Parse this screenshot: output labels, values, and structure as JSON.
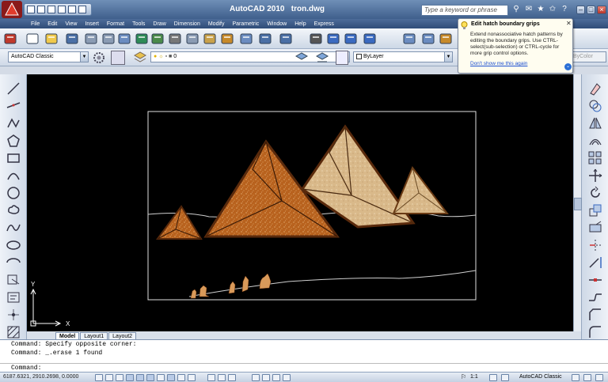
{
  "title_bar": {
    "app_title": "AutoCAD 2010",
    "file_name": "tron.dwg",
    "search_placeholder": "Type a keyword or phrase"
  },
  "menu": [
    "File",
    "Edit",
    "View",
    "Insert",
    "Format",
    "Tools",
    "Draw",
    "Dimension",
    "Modify",
    "Parametric",
    "Window",
    "Help",
    "Express"
  ],
  "toolbar2": {
    "workspace": "AutoCAD Classic",
    "layer": "0",
    "color": "ByLayer",
    "plot_style": "ByColor"
  },
  "balloon": {
    "title": "Edit hatch boundary grips",
    "body": "Extend nonassociative hatch patterns by editing the boundary grips. Use CTRL-select(sub-selection) or CTRL-cycle for more grip control options.",
    "link": "Don't show me this again"
  },
  "ucs": {
    "x": "X",
    "y": "Y"
  },
  "layout_tabs": [
    "Model",
    "Layout1",
    "Layout2"
  ],
  "command_lines": [
    "Command: Specify opposite corner:",
    "Command: _.erase 1 found",
    "Command:"
  ],
  "status_bar": {
    "coordinates": "6187.6321, 2910.2698, 0.0000",
    "annotation_scale": "1:1",
    "workspace": "AutoCAD Classic"
  },
  "colors": {
    "title_bar": "#3f5f8c",
    "drawing_background": "#000000",
    "pyramid_dark": "#b8621e",
    "pyramid_light": "#d9b98a",
    "pyramid_outline": "#5a2a0c"
  }
}
